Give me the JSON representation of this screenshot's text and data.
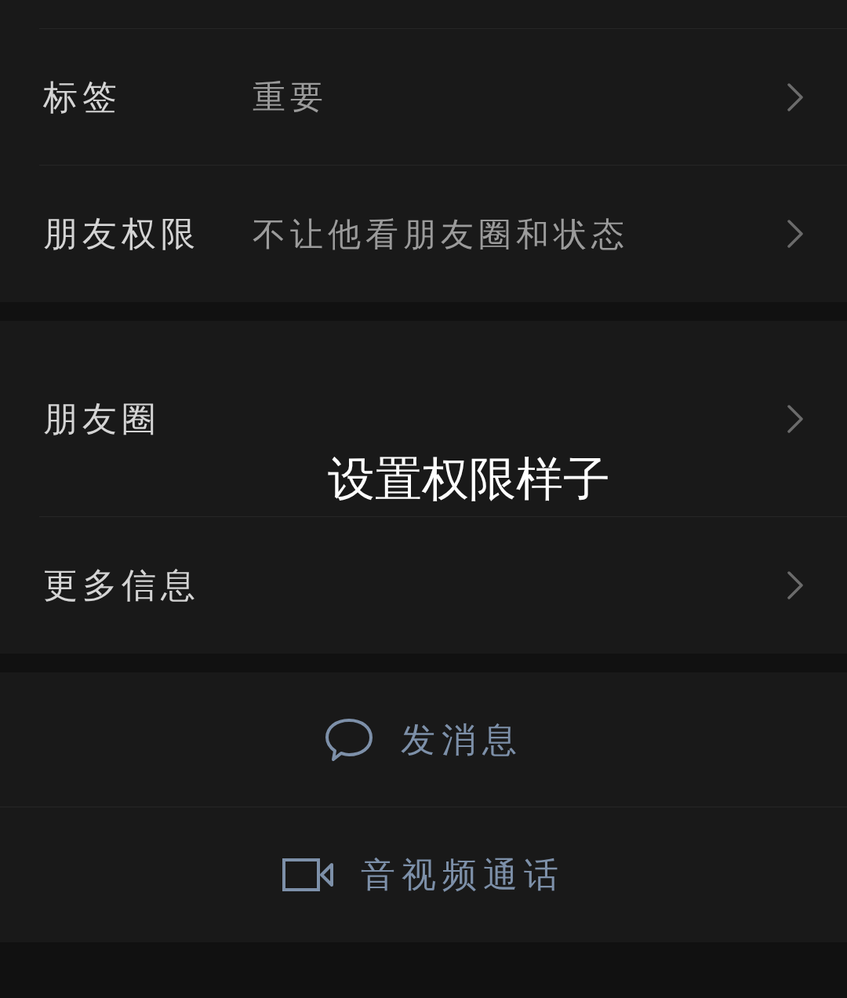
{
  "sections": [
    {
      "rows": [
        {
          "label": "标签",
          "value": "重要"
        },
        {
          "label": "朋友权限",
          "value": "不让他看朋友圈和状态"
        }
      ]
    },
    {
      "rows": [
        {
          "label": "朋友圈",
          "tall": true
        },
        {
          "label": "更多信息"
        }
      ]
    }
  ],
  "actions": [
    {
      "kind": "message",
      "label": "发消息"
    },
    {
      "kind": "video",
      "label": "音视频通话"
    }
  ],
  "caption": "设置权限样子"
}
